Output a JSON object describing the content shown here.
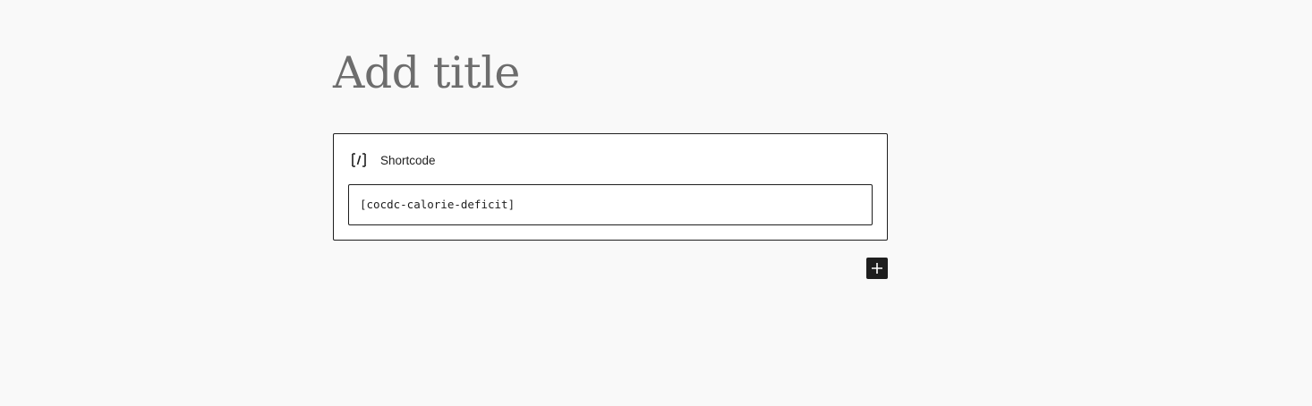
{
  "editor": {
    "title_placeholder": "Add title"
  },
  "shortcode_block": {
    "icon": "shortcode-icon",
    "label": "Shortcode",
    "value": "[cocdc-calorie-deficit]"
  },
  "inserter": {
    "icon": "plus-icon"
  },
  "colors": {
    "background": "#f9f9f9",
    "border": "#1e1e1e",
    "title_placeholder": "#6d6d6d"
  }
}
